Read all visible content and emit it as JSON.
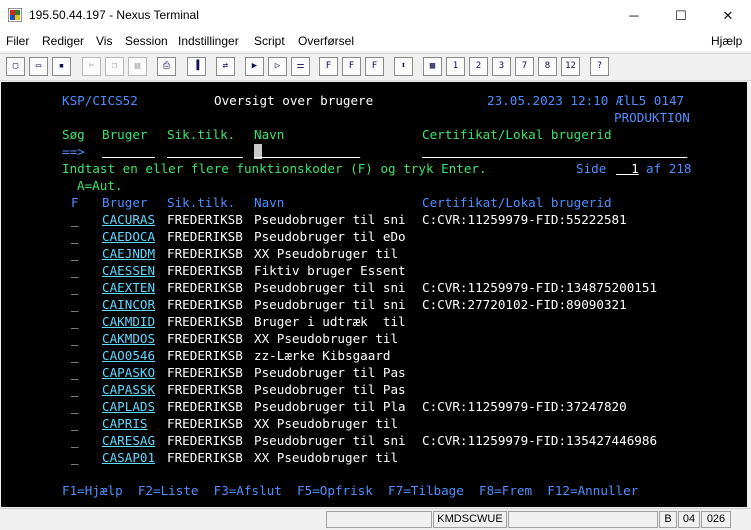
{
  "window": {
    "title": "195.50.44.197 - Nexus Terminal",
    "minimize_glyph": "─",
    "maximize_glyph": "☐",
    "close_glyph": "✕"
  },
  "menu": [
    "Filer",
    "Rediger",
    "Vis",
    "Session",
    "Indstillinger",
    "Script",
    "Overførsel"
  ],
  "help_menu": "Hjælp",
  "toolbar": [
    {
      "name": "new-document-icon",
      "glyph": "▢"
    },
    {
      "name": "open-folder-icon",
      "glyph": "▭"
    },
    {
      "name": "save-icon",
      "glyph": "▪"
    },
    {
      "name": "cut-icon",
      "glyph": "✂"
    },
    {
      "name": "copy-icon",
      "glyph": "❐"
    },
    {
      "name": "paste-icon",
      "glyph": "▤"
    },
    {
      "name": "print-icon",
      "glyph": "⎙"
    },
    {
      "name": "exit-screen-icon",
      "glyph": "▐"
    },
    {
      "name": "transfer-icon",
      "glyph": "⇄"
    },
    {
      "name": "pa1-icon",
      "glyph": "▶"
    },
    {
      "name": "pa2-icon",
      "glyph": "▷"
    },
    {
      "name": "reset-icon",
      "glyph": "⚌"
    },
    {
      "name": "pf-icon",
      "glyph": "F"
    },
    {
      "name": "pf-icon",
      "glyph": "F"
    },
    {
      "name": "pf-icon",
      "glyph": "F"
    },
    {
      "name": "updown-icon",
      "glyph": "⬍"
    },
    {
      "name": "keypad-icon",
      "glyph": "▦"
    },
    {
      "name": "pf1-icon",
      "glyph": "1"
    },
    {
      "name": "pf2-icon",
      "glyph": "2"
    },
    {
      "name": "pf3-icon",
      "glyph": "3"
    },
    {
      "name": "pf7-icon",
      "glyph": "7"
    },
    {
      "name": "pf8-icon",
      "glyph": "8"
    },
    {
      "name": "pf12-icon",
      "glyph": "12"
    },
    {
      "name": "help-icon",
      "glyph": "?"
    }
  ],
  "terminal": {
    "header_left": "KSP/CICS52",
    "header_title": "Oversigt over brugere",
    "header_date": "23.05.2023 12:10 ÆlL5 0147",
    "header_env": "PRODUKTION",
    "search_label": "Søg",
    "col_bruger": "Bruger",
    "col_sik": "Sik.tilk.",
    "col_navn": "Navn",
    "col_cert": "Certifikat/Lokal brugerid",
    "prompt_arrow": "==>",
    "instruction": "Indtast en eller flere funktionskoder (F) og tryk Enter.",
    "side_label": "Side",
    "page_number": "1",
    "page_of": "af 218",
    "aut_hint": "A=Aut.",
    "col_f": "F",
    "rows": [
      {
        "f": "_",
        "bruger": "CACURAS",
        "sik": "FREDERIKSB",
        "navn": "Pseudobruger til sni",
        "cert": "C:CVR:11259979-FID:55222581"
      },
      {
        "f": "_",
        "bruger": "CAEDOCA",
        "sik": "FREDERIKSB",
        "navn": "Pseudobruger til eDo",
        "cert": ""
      },
      {
        "f": "_",
        "bruger": "CAEJNDM",
        "sik": "FREDERIKSB",
        "navn": "XX Pseudobruger til",
        "cert": ""
      },
      {
        "f": "_",
        "bruger": "CAESSEN",
        "sik": "FREDERIKSB",
        "navn": "Fiktiv bruger Essent",
        "cert": ""
      },
      {
        "f": "_",
        "bruger": "CAEXTEN",
        "sik": "FREDERIKSB",
        "navn": "Pseudobruger til sni",
        "cert": "C:CVR:11259979-FID:134875200151"
      },
      {
        "f": "_",
        "bruger": "CAINCOR",
        "sik": "FREDERIKSB",
        "navn": "Pseudobruger til sni",
        "cert": "C:CVR:27720102-FID:89090321"
      },
      {
        "f": "_",
        "bruger": "CAKMDID",
        "sik": "FREDERIKSB",
        "navn": "Bruger i udtræk  til",
        "cert": ""
      },
      {
        "f": "_",
        "bruger": "CAKMDOS",
        "sik": "FREDERIKSB",
        "navn": "XX Pseudobruger til",
        "cert": ""
      },
      {
        "f": "_",
        "bruger": "CAO0546",
        "sik": "FREDERIKSB",
        "navn": "zz-Lærke Kibsgaard",
        "cert": ""
      },
      {
        "f": "_",
        "bruger": "CAPASKO",
        "sik": "FREDERIKSB",
        "navn": "Pseudobruger til Pas",
        "cert": ""
      },
      {
        "f": "_",
        "bruger": "CAPASSK",
        "sik": "FREDERIKSB",
        "navn": "Pseudobruger til Pas",
        "cert": ""
      },
      {
        "f": "_",
        "bruger": "CAPLADS",
        "sik": "FREDERIKSB",
        "navn": "Pseudobruger til Pla",
        "cert": "C:CVR:11259979-FID:37247820"
      },
      {
        "f": "_",
        "bruger": "CAPRIS",
        "sik": "FREDERIKSB",
        "navn": "XX Pseudobruger til",
        "cert": ""
      },
      {
        "f": "_",
        "bruger": "CARESAG",
        "sik": "FREDERIKSB",
        "navn": "Pseudobruger til sni",
        "cert": "C:CVR:11259979-FID:135427446986"
      },
      {
        "f": "_",
        "bruger": "CASAP01",
        "sik": "FREDERIKSB",
        "navn": "XX Pseudobruger til",
        "cert": ""
      }
    ],
    "function_keys": "F1=Hjælp  F2=Liste  F3=Afslut  F5=Opfrisk  F7=Tilbage  F8=Frem  F12=Annuller"
  },
  "status": {
    "session": "KMDSCWUE",
    "mode": "B",
    "cursor_row": "04",
    "cursor_col": "026"
  },
  "colors": {
    "terminal_bg": "#000000",
    "field_blue": "#4f8eff",
    "input_white": "#ffffff",
    "prompt_green": "#3ce36a",
    "text_cyan": "#5fd9ff"
  }
}
